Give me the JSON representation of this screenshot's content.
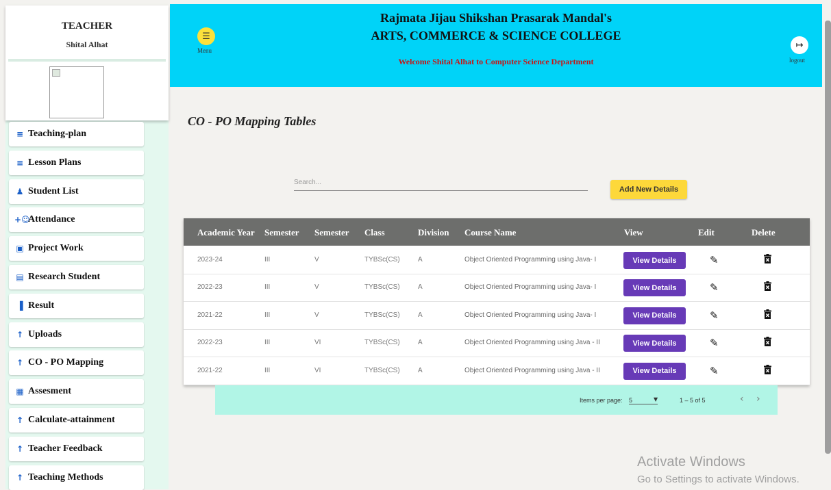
{
  "profile": {
    "role": "TEACHER",
    "name": "Shital Alhat"
  },
  "sidebar": {
    "items": [
      {
        "label": "Teaching-plan",
        "icon": "edit-list-icon"
      },
      {
        "label": "Lesson Plans",
        "icon": "edit-list-icon"
      },
      {
        "label": "Student List",
        "icon": "student-icon"
      },
      {
        "label": "Attendance",
        "icon": "add-person-icon"
      },
      {
        "label": "Project Work",
        "icon": "folder-icon"
      },
      {
        "label": "Research Student",
        "icon": "archive-icon"
      },
      {
        "label": "Result",
        "icon": "bar-chart-icon"
      },
      {
        "label": "Uploads",
        "icon": "upload-icon"
      },
      {
        "label": "CO - PO Mapping",
        "icon": "upload-icon"
      },
      {
        "label": "Assesment",
        "icon": "assessment-icon"
      },
      {
        "label": "Calculate-attainment",
        "icon": "upload-icon"
      },
      {
        "label": "Teacher Feedback",
        "icon": "upload-icon"
      },
      {
        "label": "Teaching Methods",
        "icon": "upload-icon"
      }
    ]
  },
  "header": {
    "menu_label": "Menu",
    "title_line1": "Rajmata Jijau Shikshan Prasarak Mandal's",
    "title_line2": "ARTS, COMMERCE & SCIENCE COLLEGE",
    "welcome": "Welcome Shital Alhat to Computer Science Department",
    "logout_label": "logout"
  },
  "main": {
    "title": "CO - PO Mapping Tables",
    "search_placeholder": "Search...",
    "add_button": "Add New Details",
    "columns": [
      "Academic Year",
      "Semester",
      "Semester",
      "Class",
      "Division",
      "Course Name",
      "View",
      "Edit",
      "Delete"
    ],
    "view_button": "View Details",
    "rows": [
      {
        "year": "2023-24",
        "sem1": "III",
        "sem2": "V",
        "class": "TYBSc(CS)",
        "division": "A",
        "course": "Object Oriented Programming using Java- I"
      },
      {
        "year": "2022-23",
        "sem1": "III",
        "sem2": "V",
        "class": "TYBSc(CS)",
        "division": "A",
        "course": "Object Oriented Programming using Java- I"
      },
      {
        "year": "2021-22",
        "sem1": "III",
        "sem2": "V",
        "class": "TYBSc(CS)",
        "division": "A",
        "course": "Object Oriented Programming using Java- I"
      },
      {
        "year": "2022-23",
        "sem1": "III",
        "sem2": "VI",
        "class": "TYBSc(CS)",
        "division": "A",
        "course": "Object Oriented Programming using Java - II"
      },
      {
        "year": "2021-22",
        "sem1": "III",
        "sem2": "VI",
        "class": "TYBSc(CS)",
        "division": "A",
        "course": "Object Oriented Programming using Java - II"
      }
    ]
  },
  "paginator": {
    "items_per_page_label": "Items per page:",
    "items_per_page": "5",
    "range": "1 – 5 of 5"
  },
  "watermark": {
    "line1": "Activate Windows",
    "line2": "Go to Settings to activate Windows."
  },
  "colors": {
    "header": "#00d3f8",
    "accent_button": "#673ab7",
    "add_button": "#fdd83a",
    "paginator": "#b1f5e6",
    "welcome_text": "#c81414"
  }
}
